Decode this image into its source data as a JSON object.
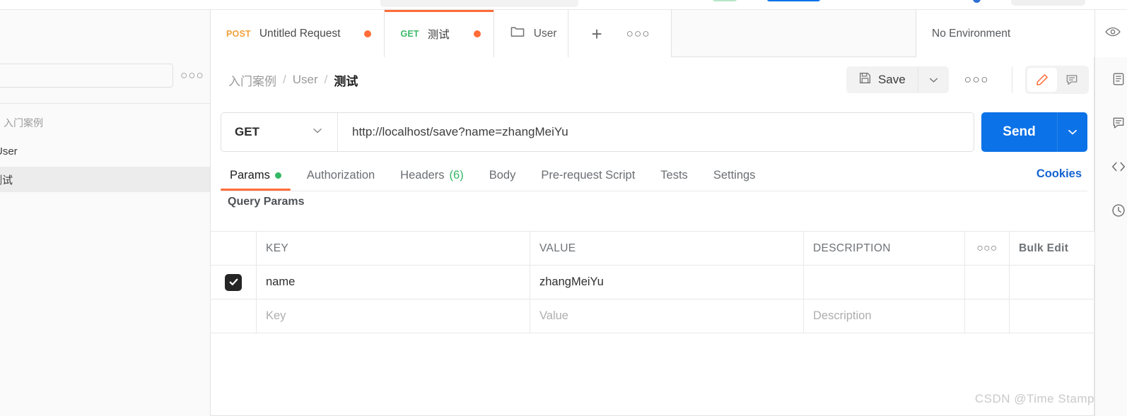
{
  "sidebar": {
    "search_placeholder": "",
    "more_icon": "more-horizontal-icon",
    "items": [
      {
        "label": "入门案例",
        "icon": "collection-icon"
      },
      {
        "label": "User",
        "icon": "folder-icon"
      },
      {
        "label": "测试",
        "icon": "request-icon"
      }
    ]
  },
  "tabbar": {
    "tabs": [
      {
        "method": "POST",
        "title": "Untitled Request",
        "unsaved": true,
        "active": false
      },
      {
        "method": "GET",
        "title": "测试",
        "unsaved": true,
        "active": true
      }
    ],
    "context": {
      "icon": "folder-icon",
      "label": "User"
    },
    "new_tab_label": "+",
    "more_label": "•••",
    "environment": {
      "selected": "No Environment",
      "caret": "chevron-down-icon"
    }
  },
  "header": {
    "breadcrumb": [
      "入门案例",
      "User",
      "测试"
    ],
    "separator": "/",
    "save_label": "Save",
    "save_icon": "floppy-disk-icon",
    "save_caret_icon": "chevron-down-icon",
    "more_label": "•••",
    "toggles": [
      {
        "icon": "pencil-icon",
        "active": true
      },
      {
        "icon": "comment-icon",
        "active": false
      }
    ]
  },
  "request": {
    "method": "GET",
    "method_caret_icon": "chevron-down-icon",
    "url": "http://localhost/save?name=zhangMeiYu",
    "send_label": "Send",
    "send_caret_icon": "chevron-down-icon"
  },
  "req_tabs": {
    "items": [
      {
        "label": "Params",
        "dot": true,
        "active": true
      },
      {
        "label": "Authorization",
        "dot": false,
        "active": false
      },
      {
        "label": "Headers",
        "count": "(6)",
        "dot": false,
        "active": false
      },
      {
        "label": "Body",
        "dot": false,
        "active": false
      },
      {
        "label": "Pre-request Script",
        "dot": false,
        "active": false
      },
      {
        "label": "Tests",
        "dot": false,
        "active": false
      },
      {
        "label": "Settings",
        "dot": false,
        "active": false
      }
    ],
    "cookies_label": "Cookies"
  },
  "params": {
    "section_title": "Query Params",
    "columns": [
      "KEY",
      "VALUE",
      "DESCRIPTION"
    ],
    "more_label": "•••",
    "bulk_edit_label": "Bulk Edit",
    "rows": [
      {
        "checked": true,
        "key": "name",
        "value": "zhangMeiYu",
        "description": "",
        "placeholder": false
      },
      {
        "checked": false,
        "key": "Key",
        "value": "Value",
        "description": "Description",
        "placeholder": true
      }
    ]
  },
  "rail": {
    "icons": [
      "documentation-icon",
      "comment-icon",
      "code-icon",
      "history-icon"
    ]
  },
  "watermark": "CSDN @Time Stamp",
  "colors": {
    "accent_orange": "#ff6c37",
    "send_blue": "#0b72e7",
    "link_blue": "#1463d1",
    "green": "#34b864",
    "method_get": "#3db96b",
    "method_post": "#f0a23c"
  }
}
